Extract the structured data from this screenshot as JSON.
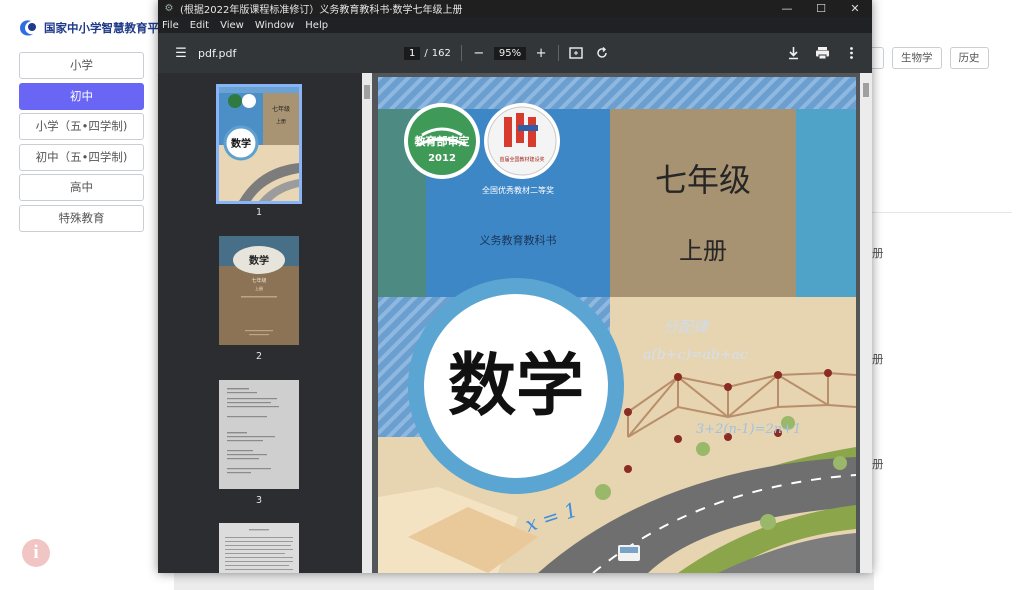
{
  "background": {
    "logo_text": "国家中小学智慧教育平台",
    "sidebar": [
      {
        "label": "小学",
        "active": false
      },
      {
        "label": "初中",
        "active": true
      },
      {
        "label": "小学（五•四学制)",
        "active": false
      },
      {
        "label": "初中（五•四学制)",
        "active": false
      },
      {
        "label": "高中",
        "active": false
      },
      {
        "label": "特殊教育",
        "active": false
      }
    ],
    "subjects": [
      "生物学",
      "历史"
    ],
    "info_icon": "i",
    "row_glyph": "册"
  },
  "viewer": {
    "window_title": "(根据2022年版课程标准修订）义务教育教科书·数学七年级上册",
    "window_buttons": {
      "minimize": "—",
      "maximize": "☐",
      "close": "✕"
    },
    "menu": [
      "File",
      "Edit",
      "View",
      "Window",
      "Help"
    ],
    "toolbar": {
      "doc_name": "pdf.pdf",
      "current_page": "1",
      "page_sep": "/",
      "total_pages": "162",
      "zoom": "95%",
      "zoom_out": "−",
      "zoom_in": "+"
    },
    "thumbnails": [
      {
        "number": "1",
        "selected": true
      },
      {
        "number": "2",
        "selected": false
      },
      {
        "number": "3",
        "selected": false
      }
    ],
    "cover": {
      "badge_top": "教育部审定",
      "badge_year": "2012",
      "award": "全国优秀教材二等奖",
      "award_badge_text": "首届全国教材建设奖",
      "series": "义务教育教科书",
      "grade": "七年级",
      "volume": "上册",
      "subject": "数学",
      "handwriting_1": "分配律",
      "handwriting_2": "a(b+c)=ab+ac",
      "handwriting_3": "3+2(n-1)=2n+1",
      "handwriting_4": "x = 1"
    },
    "thumb_1": {
      "mini_subject": "数学",
      "mini_grade": "七年级",
      "mini_volume": "上册"
    },
    "thumb_2": {
      "mini_subject": "数学",
      "mini_grade": "七年级",
      "mini_volume": "上册"
    }
  }
}
